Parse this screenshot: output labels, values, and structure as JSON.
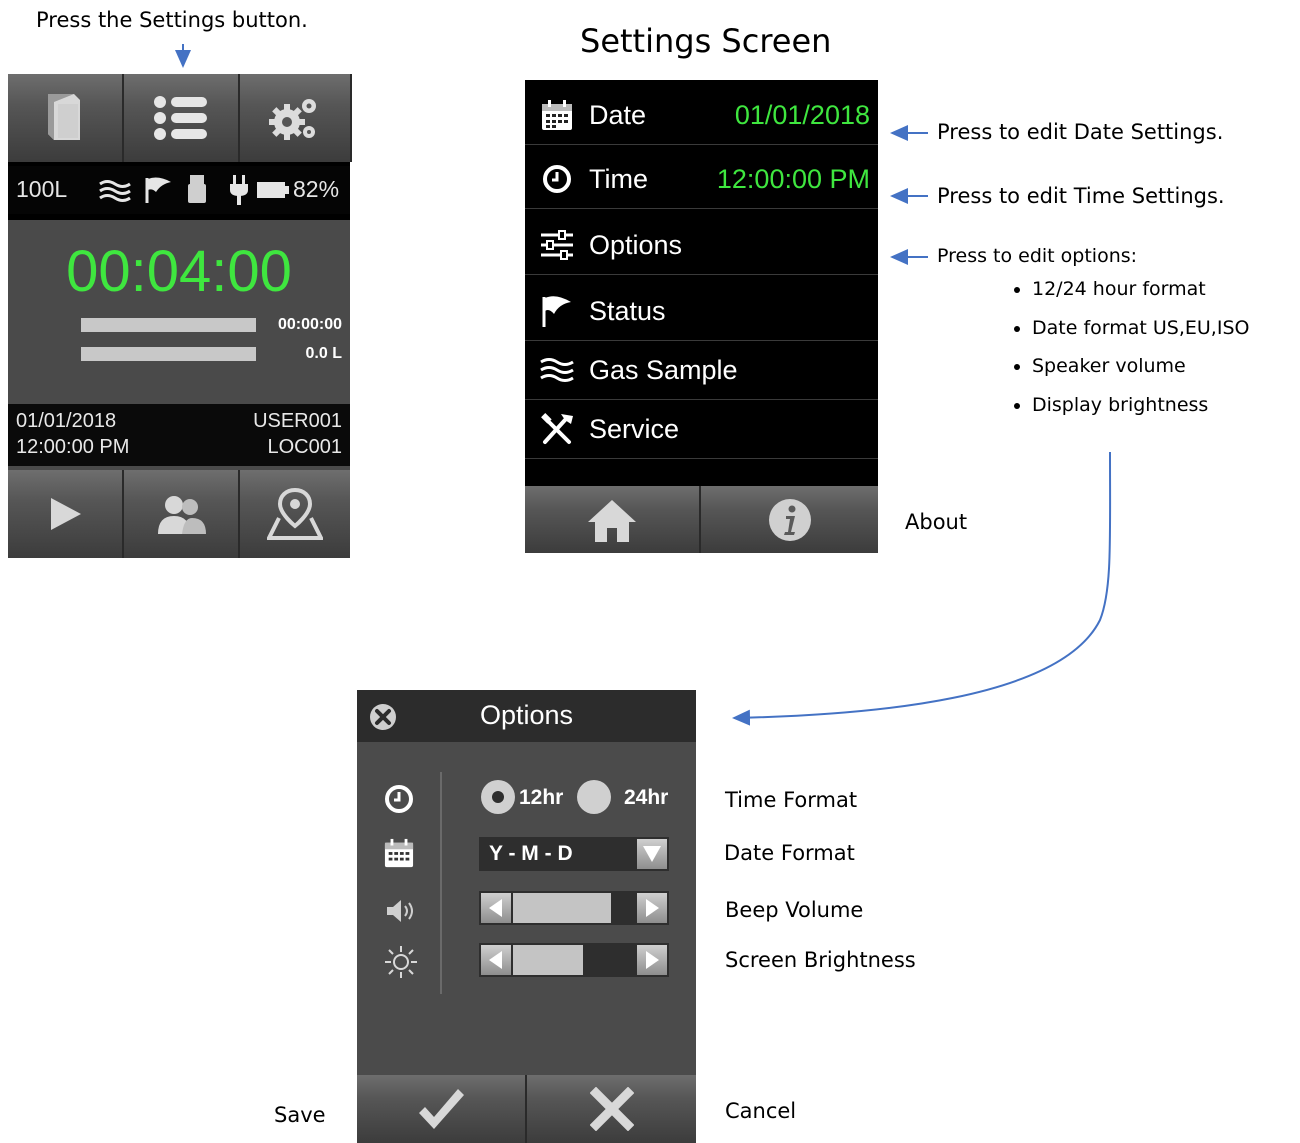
{
  "annotations": {
    "press_settings": "Press the Settings button.",
    "settings_screen_title": "Settings Screen",
    "edit_date": "Press to edit Date Settings.",
    "edit_time": "Press to edit Time Settings.",
    "edit_options": "Press to edit options:",
    "option_bullets": [
      "12/24 hour format",
      "Date format US,EU,ISO",
      "Speaker volume",
      "Display brightness"
    ],
    "about": "About",
    "time_format": "Time Format",
    "date_format": "Date Format",
    "beep_volume": "Beep Volume",
    "screen_brightness": "Screen Brightness",
    "save": "Save",
    "cancel": "Cancel"
  },
  "home": {
    "toolbar_icons": [
      "book-icon",
      "list-icon",
      "gears-icon"
    ],
    "status": {
      "volume": "100L",
      "battery": "82%",
      "icons": [
        "gas-wave-icon",
        "flag-icon",
        "usb-icon",
        "plug-icon",
        "battery-icon"
      ]
    },
    "timer": "00:04:00",
    "elapsed": "00:00:00",
    "volume_collected": "0.0 L",
    "elapsed_progress": 0,
    "volume_progress": 0,
    "date": "01/01/2018",
    "time": "12:00:00 PM",
    "user": "USER001",
    "location": "LOC001",
    "bottom_icons": [
      "play-icon",
      "users-icon",
      "location-icon"
    ]
  },
  "settings": {
    "items": [
      {
        "label": "Date",
        "value": "01/01/2018",
        "icon": "calendar-icon"
      },
      {
        "label": "Time",
        "value": "12:00:00 PM",
        "icon": "clock-icon"
      },
      {
        "label": "Options",
        "value": "",
        "icon": "sliders-icon"
      },
      {
        "label": "Status",
        "value": "",
        "icon": "flag-icon"
      },
      {
        "label": "Gas Sample",
        "value": "",
        "icon": "gas-wave-icon"
      },
      {
        "label": "Service",
        "value": "",
        "icon": "tools-icon"
      }
    ],
    "bottom_icons": [
      "home-icon",
      "info-icon"
    ]
  },
  "options": {
    "title": "Options",
    "time_format": {
      "options": [
        "12hr",
        "24hr"
      ],
      "selected": "12hr"
    },
    "date_format": {
      "value": "Y - M - D"
    },
    "beep_volume_level": 0.8,
    "brightness_level": 0.5
  },
  "colors": {
    "accent_green": "#3fe63f",
    "device_black": "#000000",
    "panel_gray": "#4b4b4b",
    "arrow_blue": "#4472c4"
  }
}
